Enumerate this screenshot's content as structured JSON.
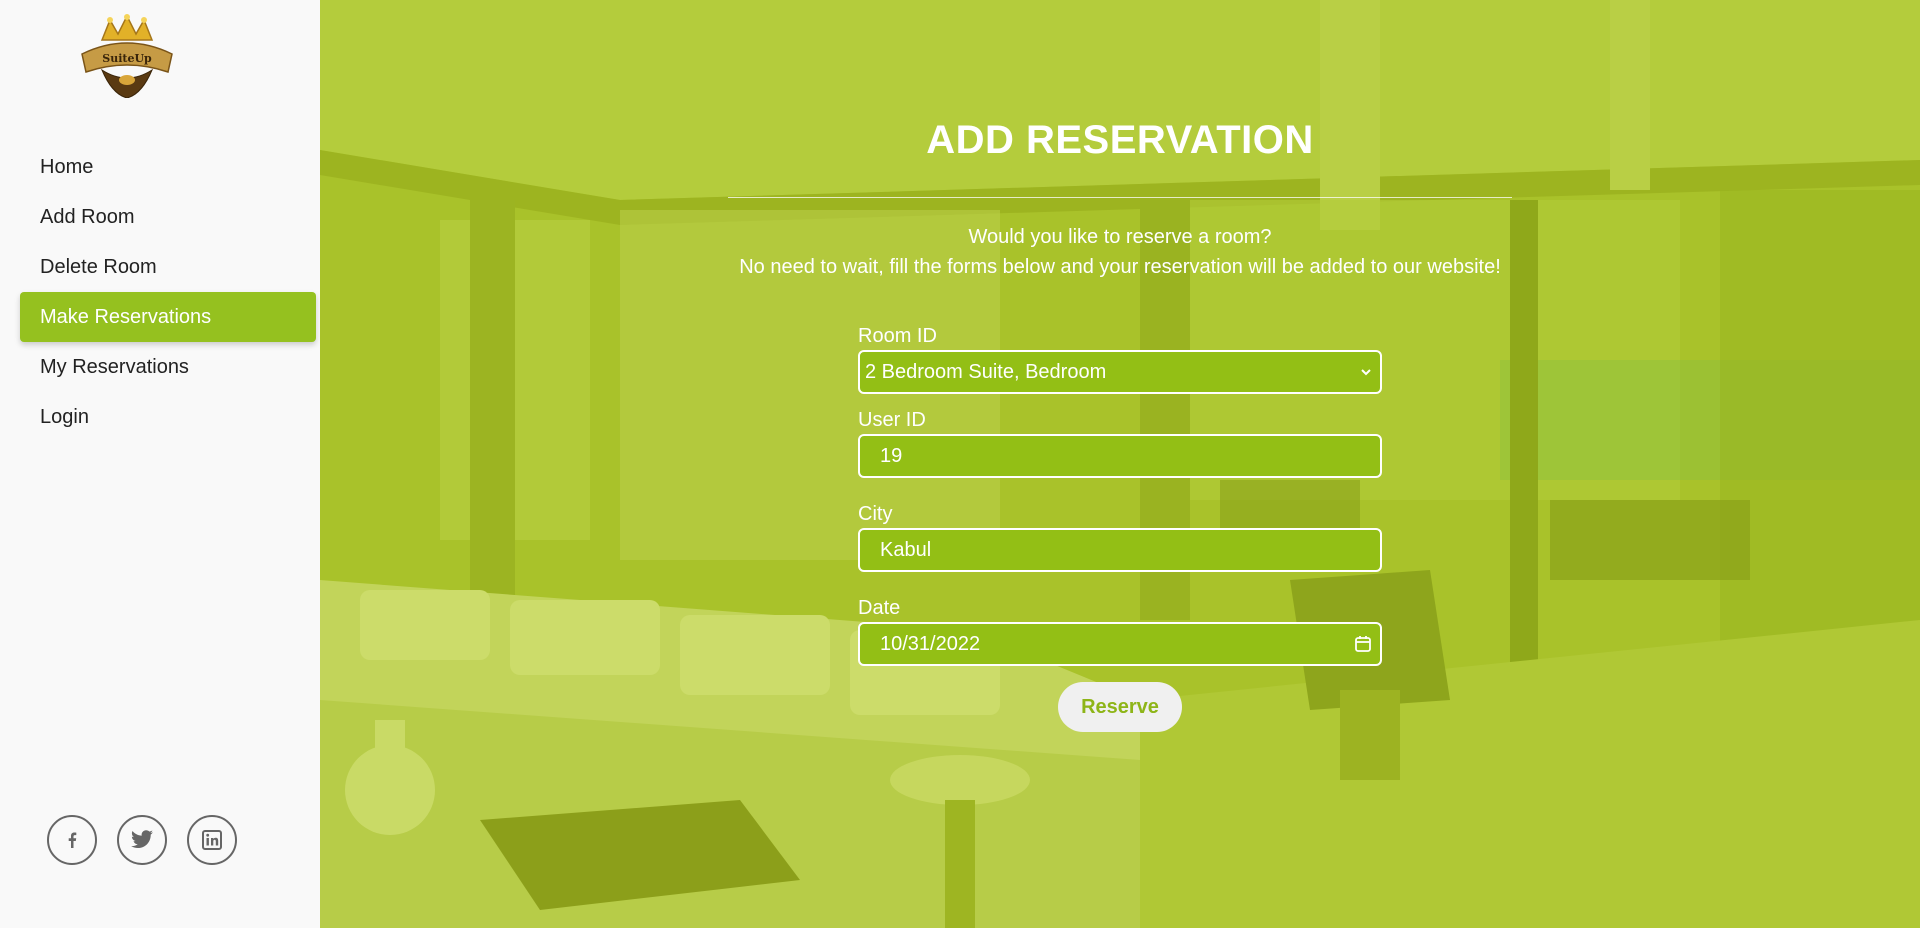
{
  "brand": {
    "logo_text": "SuiteUp"
  },
  "sidebar": {
    "items": [
      {
        "label": "Home"
      },
      {
        "label": "Add Room"
      },
      {
        "label": "Delete Room"
      },
      {
        "label": "Make Reservations"
      },
      {
        "label": "My Reservations"
      },
      {
        "label": "Login"
      }
    ],
    "active_index": 3,
    "social": [
      "facebook-icon",
      "twitter-icon",
      "linkedin-icon"
    ]
  },
  "main": {
    "title": "ADD RESERVATION",
    "subtitle_line1": "Would you like to reserve a room?",
    "subtitle_line2": "No need to wait, fill the forms below and your reservation will be added to our website!",
    "form": {
      "room_label": "Room ID",
      "room_value": "2 Bedroom Suite, Bedroom",
      "user_label": "User ID",
      "user_value": "19",
      "city_label": "City",
      "city_value": "Kabul",
      "date_label": "Date",
      "date_value": "10/31/2022",
      "submit_label": "Reserve"
    }
  },
  "colors": {
    "accent": "#95c11f",
    "overlay": "#a6c21c",
    "field_bg": "#93bf15"
  }
}
